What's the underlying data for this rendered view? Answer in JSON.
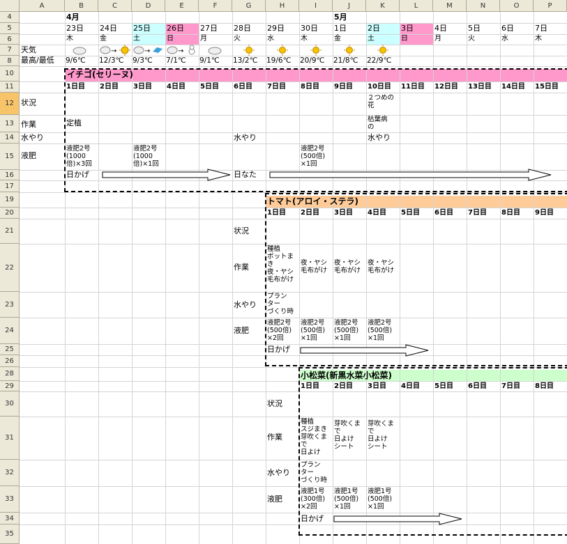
{
  "rows": [
    "4",
    "5",
    "6",
    "7",
    "8",
    "10",
    "11",
    "12",
    "13",
    "14",
    "15",
    "16",
    "17",
    "19",
    "20",
    "21",
    "22",
    "23",
    "24",
    "25",
    "26",
    "28",
    "29",
    "30",
    "31",
    "32",
    "33",
    "34",
    "35"
  ],
  "cols": [
    "A",
    "B",
    "C",
    "D",
    "E",
    "F",
    "G",
    "H",
    "I",
    "J",
    "K",
    "L",
    "M",
    "N",
    "O",
    "P"
  ],
  "calendar": {
    "april": "4月",
    "may": "5月",
    "dates": [
      "23日",
      "24日",
      "25日",
      "26日",
      "27日",
      "28日",
      "29日",
      "30日",
      "1日",
      "2日",
      "3日",
      "4日",
      "5日",
      "6日",
      "7日"
    ],
    "weekdays": [
      "木",
      "金",
      "土",
      "日",
      "月",
      "火",
      "水",
      "木",
      "金",
      "土",
      "日",
      "月",
      "火",
      "水",
      "木"
    ],
    "temps": [
      "9/6℃",
      "12/3℃",
      "9/3℃",
      "7/1℃",
      "9/1℃",
      "13/2℃",
      "19/6℃",
      "20/9℃",
      "21/8℃",
      "22/9℃"
    ],
    "weather_icons": [
      "cloud-icon",
      "cloud-to-sun-icon",
      "cloud-to-rain-icon",
      "cloud-to-snow-icon",
      "cloud-icon",
      "sun-icon",
      "sun-icon",
      "sun-icon",
      "sun-icon",
      "sun-icon"
    ]
  },
  "row_labels": {
    "weather": "天気",
    "temp": "最高/最低"
  },
  "colors": {
    "saturday": "#ccffff",
    "sunday": "#ff99cc",
    "strawberry": "#ff99cc",
    "tomato": "#ffcc99",
    "komatsuna": "#ccffcc"
  },
  "strawberry": {
    "title": "イチゴ(セリーヌ)",
    "days": [
      "1日目",
      "2日目",
      "3日目",
      "4日目",
      "5日目",
      "6日目",
      "7日目",
      "8日目",
      "9日目",
      "10日目",
      "11日目",
      "12日目",
      "13日目",
      "14日目",
      "15日目"
    ],
    "labels": {
      "status": "状況",
      "work": "作業",
      "water": "水やり",
      "fertilizer": "液肥"
    },
    "status_k": "２つめの\n花",
    "work_b": "定植",
    "work_k": "枯葉病\nの",
    "water_g": "水やり",
    "water_k": "水やり",
    "fert_b": "液肥2号\n(1000\n倍)×3回",
    "fert_d": "液肥2号\n(1000\n倍)×1回",
    "fert_i": "液肥2号\n(500倍)\n×1回",
    "shade": "日かげ",
    "sun": "日なた"
  },
  "tomato": {
    "title": "トマト(アロイ・ステラ)",
    "days": [
      "1日目",
      "2日目",
      "3日目",
      "4日目",
      "5日目",
      "6日目",
      "7日目",
      "8日目",
      "9日目"
    ],
    "labels": {
      "status": "状況",
      "work": "作業",
      "water": "水やり",
      "fertilizer": "液肥"
    },
    "work_h": "種植\nポットま\nき\n夜・ヤシ\n毛布がけ",
    "work_i": "夜・ヤシ\n毛布がけ",
    "work_j": "夜・ヤシ\n毛布がけ",
    "work_k": "夜・ヤシ\n毛布がけ",
    "water_h": "プラン\nター\nづくり時",
    "fert_h": "液肥2号\n(500倍)\n×2回",
    "fert_i": "液肥2号\n(500倍)\n×1回",
    "fert_j": "液肥2号\n(500倍)\n×1回",
    "fert_k": "液肥2号\n(500倍)\n×1回",
    "shade": "日かげ"
  },
  "komatsuna": {
    "title": "小松菜(新黒水菜小松菜)",
    "days": [
      "1日目",
      "2日目",
      "3日目",
      "4日目",
      "5日目",
      "6日目",
      "7日目",
      "8日目"
    ],
    "labels": {
      "status": "状況",
      "work": "作業",
      "water": "水やり",
      "fertilizer": "液肥"
    },
    "work_i": "種植\nスジまき\n芽吹くま\nで\n日よけ",
    "work_j": "芽吹くま\nで\n日よけ\nシート",
    "work_k": "芽吹くま\nで\n日よけ\nシート",
    "water_i": "プラン\nター\nづくり時",
    "fert_i": "液肥1号\n(300倍)\n×2回",
    "fert_j": "液肥1号\n(500倍)\n×1回",
    "fert_k": "液肥1号\n(500倍)\n×1回",
    "shade": "日かげ"
  }
}
